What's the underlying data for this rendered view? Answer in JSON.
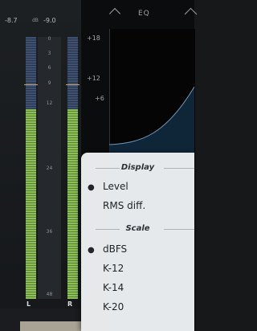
{
  "meters": {
    "left_peak": "-8.7",
    "db_unit": "dB",
    "right_peak": "-9.0",
    "scale_ticks": [
      "0",
      "3",
      "6",
      "9",
      "12",
      "24",
      "36",
      "48"
    ],
    "channel_left": "L",
    "channel_right": "R"
  },
  "eq": {
    "title": "EQ",
    "db_labels": [
      "+18",
      "+12",
      "+6"
    ]
  },
  "menu": {
    "display_header": "Display",
    "display_items": [
      {
        "label": "Level",
        "selected": true
      },
      {
        "label": "RMS diff.",
        "selected": false
      }
    ],
    "scale_header": "Scale",
    "scale_items": [
      {
        "label": "dBFS",
        "selected": true
      },
      {
        "label": "K-12",
        "selected": false
      },
      {
        "label": "K-14",
        "selected": false
      },
      {
        "label": "K-20",
        "selected": false
      }
    ],
    "bullet": "●"
  },
  "colors": {
    "meter_green": "#8cc055",
    "meter_blue": "#445a80",
    "peak_line": "#c9a45e",
    "menu_bg": "#eff1f3"
  }
}
